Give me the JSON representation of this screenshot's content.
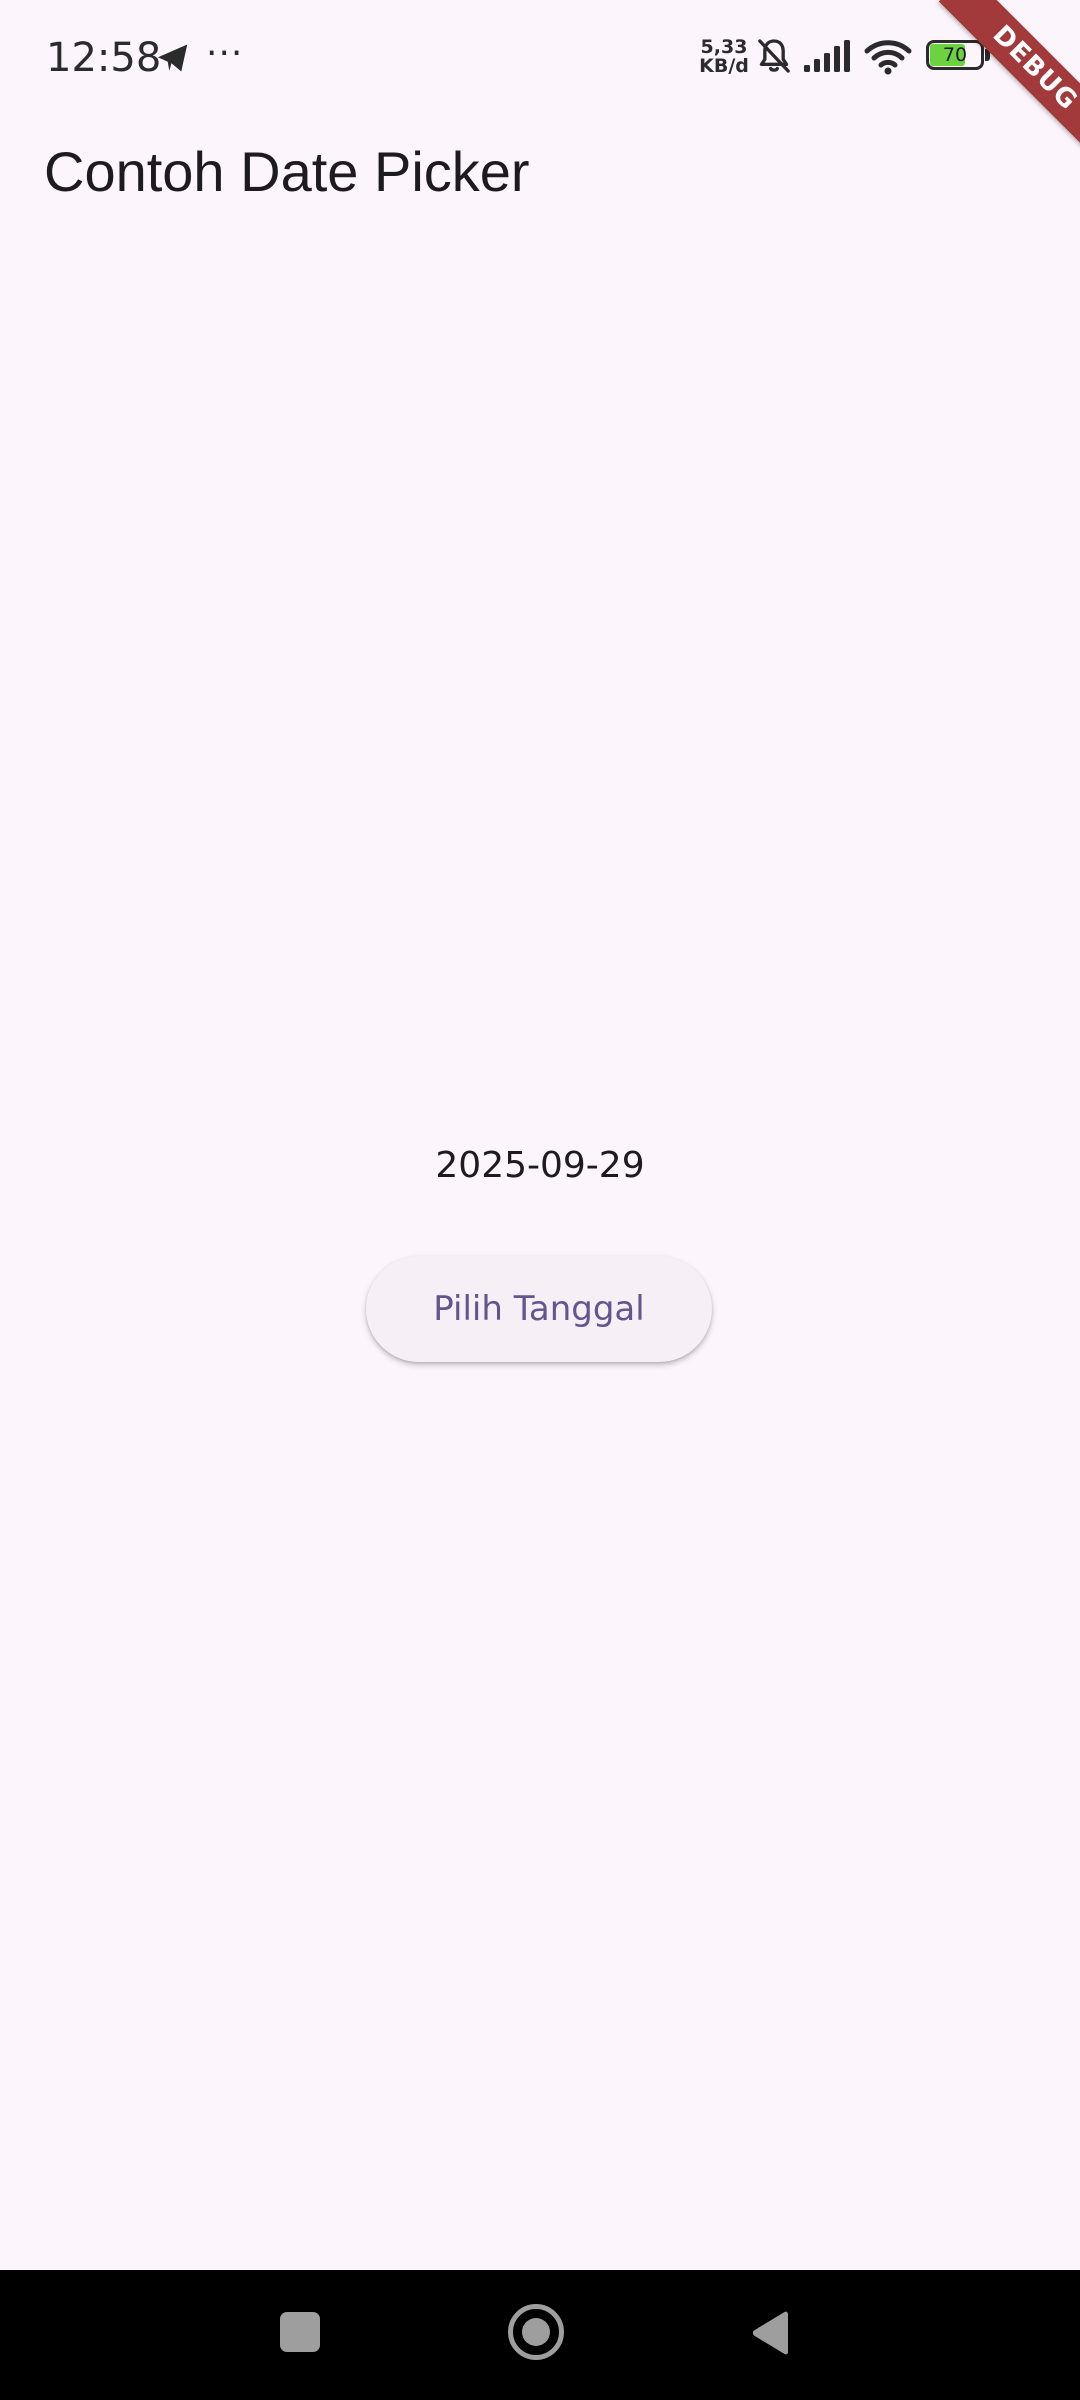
{
  "status_bar": {
    "time": "12:58",
    "more_indicator": "···",
    "net_speed_value": "5,33",
    "net_speed_unit": "KB/d",
    "battery_level": "70",
    "icons": [
      "telegram-icon",
      "bell-off-icon",
      "signal-icon",
      "wifi-icon",
      "battery-icon"
    ]
  },
  "debug_banner": {
    "label": "DEBUG",
    "color": "#A2393B"
  },
  "app_bar": {
    "title": "Contoh Date Picker"
  },
  "main": {
    "selected_date": "2025-09-29",
    "pick_button_label": "Pilih Tanggal"
  },
  "colors": {
    "background": "#FCF5FC",
    "button_text": "#65558F",
    "button_background": "#F6EFF6"
  },
  "nav_bar": {
    "icons": [
      "recents-icon",
      "home-icon",
      "back-icon"
    ]
  }
}
